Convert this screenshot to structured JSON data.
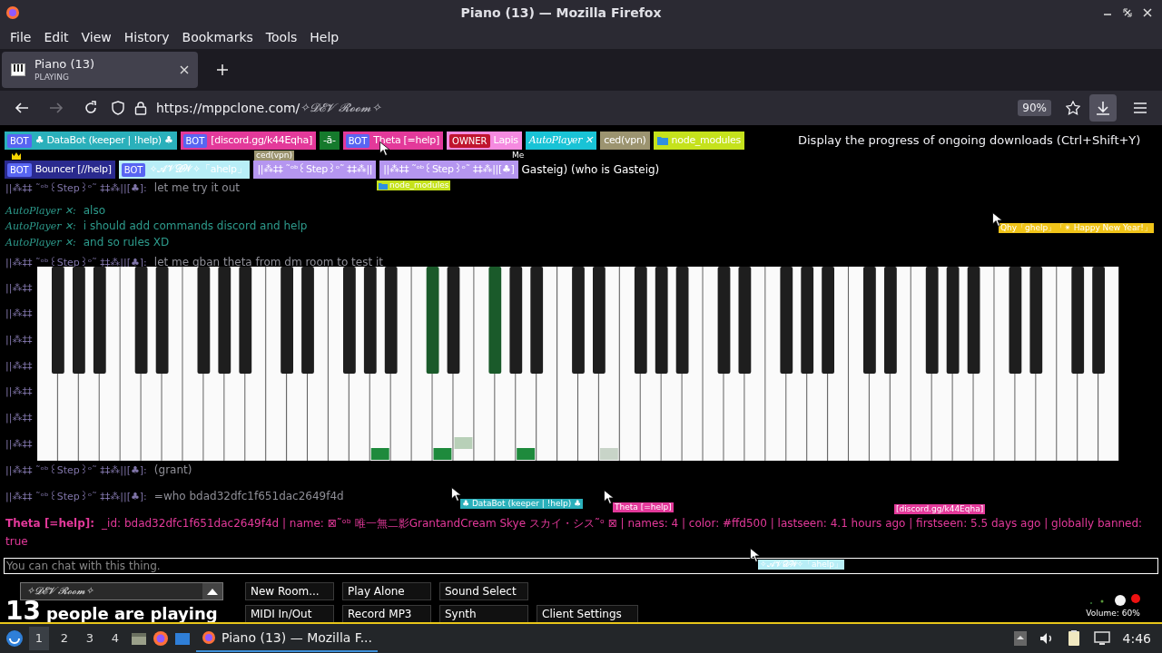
{
  "window": {
    "title": "Piano (13) — Mozilla Firefox"
  },
  "menu": [
    "File",
    "Edit",
    "View",
    "History",
    "Bookmarks",
    "Tools",
    "Help"
  ],
  "tabs": [
    {
      "title": "Piano (13)",
      "subtitle": "PLAYING",
      "selected": true
    }
  ],
  "address_bar": {
    "url_host": "https://mppclone.com/",
    "url_path": "✧𝓓𝓔𝓥 𝓡𝓸𝓸𝓶✧",
    "zoom": "90%"
  },
  "downloads_button": {
    "highlighted": true
  },
  "tooltip": "Display the progress of ongoing downloads (Ctrl+Shift+Y)",
  "user_rows": [
    [
      {
        "kind": "badge",
        "tag": {
          "text": "BOT",
          "kind": "bot"
        },
        "name": "♣ DataBot (keeper | !help) ♣",
        "color": "#2ab0bb"
      },
      {
        "kind": "badge",
        "tag": {
          "text": "BOT",
          "kind": "bot"
        },
        "name": "[discord.gg/k44Eqha]",
        "color": "#e3399a"
      },
      {
        "kind": "badge",
        "name": "-ā-",
        "color": "#157a2c"
      },
      {
        "kind": "badge",
        "tag": {
          "text": "BOT",
          "kind": "bot"
        },
        "name": "Theta [=help]",
        "color": "#e3399a"
      },
      {
        "kind": "badge",
        "tag": {
          "text": "OWNER",
          "kind": "owner"
        },
        "name": "Lapis",
        "color": "#f58ae0"
      },
      {
        "kind": "italic_badge",
        "name": "AutoPlayer ✕",
        "color": "#19c3d6"
      },
      {
        "kind": "badge",
        "name": "ced(vpn)",
        "color": "#9c9470"
      },
      {
        "kind": "folder_badge",
        "name": "node_modules",
        "color": "#c5e21c"
      }
    ],
    [
      {
        "kind": "crowned_badge",
        "tag": {
          "text": "BOT",
          "kind": "bot"
        },
        "name": "Bouncer [//help]",
        "color": "#2a2a8e"
      },
      {
        "kind": "badge",
        "tag": {
          "text": "BOT",
          "kind": "bot"
        },
        "name": "✧𝓐𝓥𝓓𝓦✧「ahelp」",
        "color": "#b8eef7"
      },
      {
        "kind": "badge",
        "name": "||⁂‡‡ ˜ᵒᵇ꒰Step꒱ᵒ˜ ‡‡⁂||",
        "color": "#b596f0"
      },
      {
        "kind": "badge",
        "name": "||⁂‡‡ ˜ᵒᵇ꒰Step꒱ᵒ˜ ‡‡⁂||[♣]",
        "color": "#b596f0"
      },
      {
        "kind": "text",
        "name": "Gasteig) (who is Gasteig)"
      }
    ]
  ],
  "chat": [
    {
      "kind": "step",
      "name": "||⁂‡‡ ˜ᵒᵇ꒰Step꒱ᵒ˜ ‡‡⁂||[♣]:",
      "message": "let me try it out"
    },
    {
      "kind": "autoplayer",
      "name": "AutoPlayer ✕:",
      "message": "also"
    },
    {
      "kind": "autoplayer",
      "name": "AutoPlayer ✕:",
      "message": "i should add commands discord and help"
    },
    {
      "kind": "autoplayer",
      "name": "AutoPlayer ✕:",
      "message": "and so rules XD"
    },
    {
      "kind": "step",
      "name": "||⁂‡‡ ˜ᵒᵇ꒰Step꒱ᵒ˜ ‡‡⁂||[♣]:",
      "message": "let me gban theta from dm room to test it"
    },
    {
      "kind": "covered",
      "name": "||⁂‡‡"
    },
    {
      "kind": "covered",
      "name": "||⁂‡‡"
    },
    {
      "kind": "covered",
      "name": "||⁂‡‡"
    },
    {
      "kind": "covered",
      "name": "||⁂‡‡"
    },
    {
      "kind": "covered",
      "name": "||⁂‡‡"
    },
    {
      "kind": "covered",
      "name": "||⁂‡‡"
    },
    {
      "kind": "covered",
      "name": "||⁂‡‡"
    },
    {
      "kind": "step",
      "name": "||⁂‡‡ ˜ᵒᵇ꒰Step꒱ᵒ˜ ‡‡⁂||[♣]:",
      "message": "(grant)"
    },
    {
      "kind": "step",
      "name": "||⁂‡‡ ˜ᵒᵇ꒰Step꒱ᵒ˜ ‡‡⁂||[♣]:",
      "message": "=who bdad32dfc1f651dac2649f4d"
    },
    {
      "kind": "theta",
      "name": "Theta [=help]:",
      "message": "_id: bdad32dfc1f651dac2649f4d | name: ⊠˜ᵒᵇ 唯一無二影GrantandCream Skye スカイ・シス˜ᵒ ⊠ | names: 4 | color: #ffd500 | lastseen: 4.1 hours ago | firstseen: 5.5 days ago | globally banned: true"
    }
  ],
  "cursor_labels": [
    {
      "kind": "label",
      "label": "ced(vpn)",
      "color": "#9c9470"
    },
    {
      "kind": "label",
      "label": "Me",
      "color": "#000000"
    },
    {
      "kind": "folder_label",
      "label": "node_modules",
      "color": "#c5e21c"
    },
    {
      "kind": "label",
      "label": "Qhy「ghelp」「✴ Happy New Year!」",
      "color": "#f0c419"
    },
    {
      "kind": "label",
      "label": "♣ DataBot (keeper | !help) ♣",
      "color": "#2ab0bb"
    },
    {
      "kind": "label",
      "label": "Theta [=help]",
      "color": "#e3399a"
    },
    {
      "kind": "label",
      "label": "[discord.gg/k44Eqha]",
      "color": "#e3399a"
    },
    {
      "kind": "label",
      "label": "✧𝓐𝓥𝓓𝓦✧「ahelp」",
      "color": "#b8eef7"
    }
  ],
  "chat_input": {
    "placeholder": "You can chat with this thing."
  },
  "room": {
    "name": "✧𝓓𝓔𝓥 𝓡𝓸𝓸𝓶✧"
  },
  "player_count": {
    "number": "13",
    "label": "people are playing"
  },
  "buttons": [
    "New Room...",
    "Play Alone",
    "Sound Select",
    "MIDI In/Out",
    "Record MP3",
    "Synth",
    "Client Settings"
  ],
  "volume": {
    "label": "Volume: 60%"
  },
  "taskbar": {
    "workspaces": [
      {
        "label": "1",
        "selected": true
      },
      {
        "label": "2",
        "selected": false
      },
      {
        "label": "3",
        "selected": false
      },
      {
        "label": "4",
        "selected": false
      }
    ],
    "task": "Piano (13) — Mozilla F...",
    "clock": "4:46"
  }
}
